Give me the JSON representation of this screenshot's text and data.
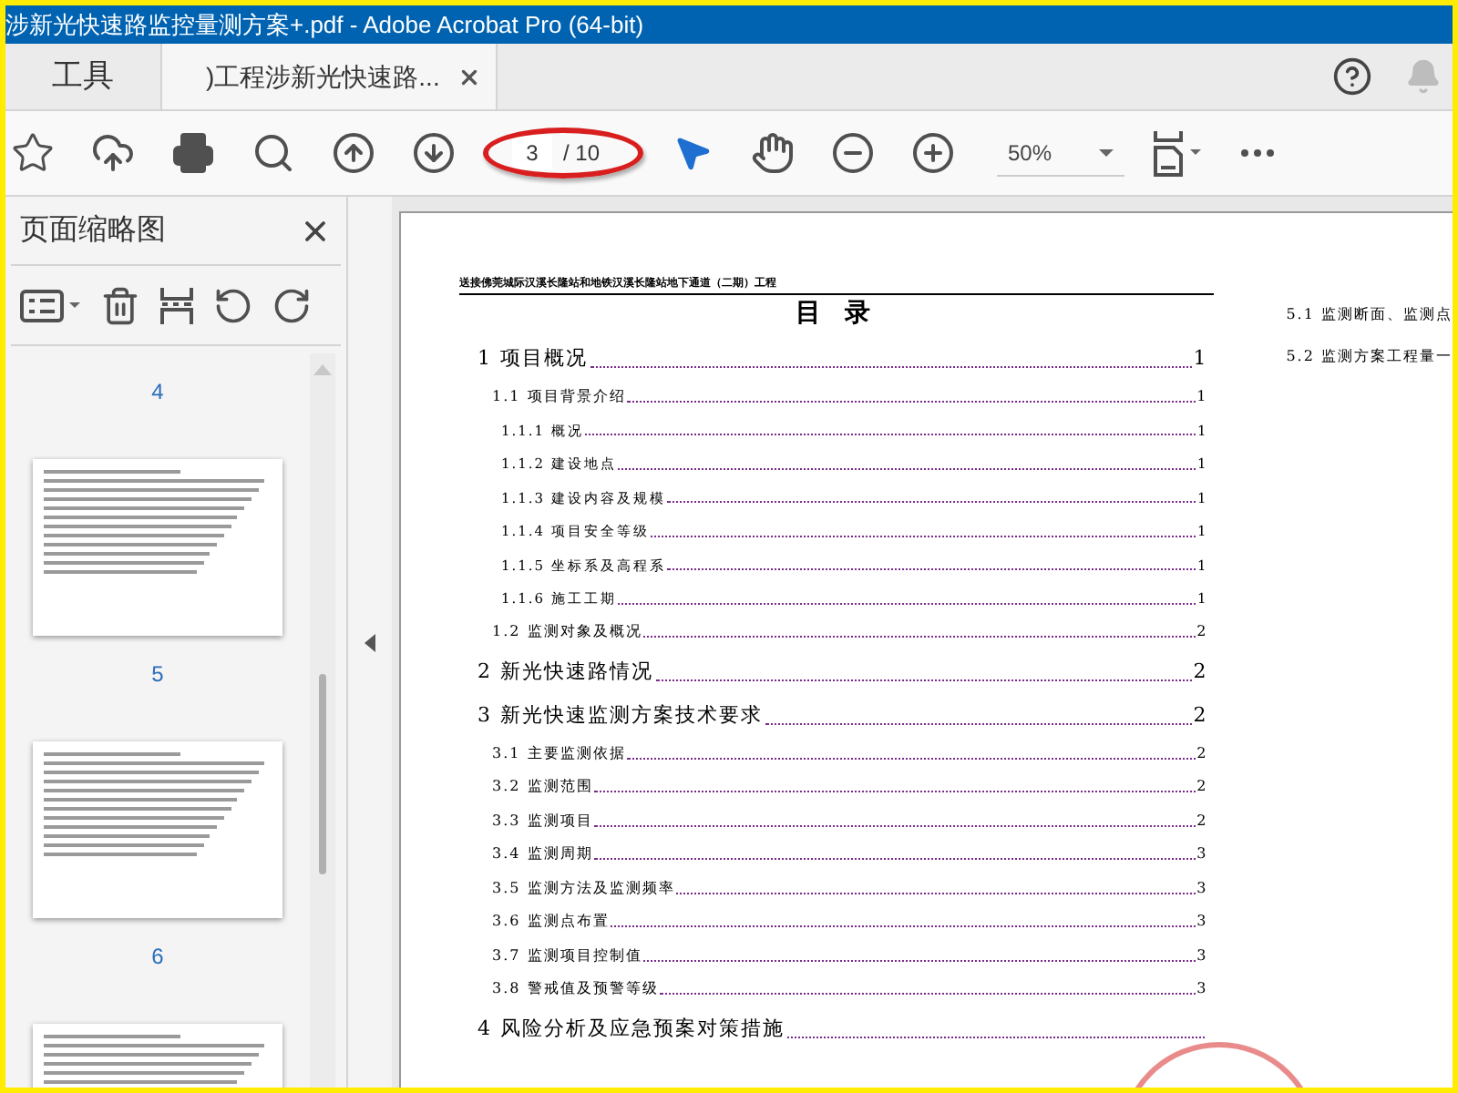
{
  "window": {
    "title": "涉新光快速路监控量测方案+.pdf - Adobe Acrobat Pro (64-bit)"
  },
  "tabs": [
    {
      "label": "工具",
      "selected": false,
      "kind": "tools"
    },
    {
      "label": ")工程涉新光快速路...",
      "selected": true,
      "kind": "document"
    }
  ],
  "toolbar": {
    "page_current": "3",
    "page_total": "/ 10",
    "zoom": "50%"
  },
  "sidebar": {
    "title": "页面缩略图",
    "thumbnails": [
      {
        "kind": "number",
        "label": "4"
      },
      {
        "kind": "thumbnail"
      },
      {
        "kind": "number",
        "label": "5"
      },
      {
        "kind": "thumbnail"
      },
      {
        "kind": "number",
        "label": "6"
      },
      {
        "kind": "thumbnail"
      }
    ]
  },
  "document": {
    "header": "送接佛莞城际汉溪长隆站和地铁汉溪长隆站地下通道（二期）工程",
    "toc_title": "目 录",
    "toc": [
      {
        "number": "1",
        "title": "项目概况",
        "page": "1",
        "children": [
          {
            "number": "1.1",
            "title": "项目背景介绍",
            "page": "1",
            "children": [
              {
                "number": "1.1.1",
                "title": "概况",
                "page": "1"
              },
              {
                "number": "1.1.2",
                "title": "建设地点",
                "page": "1"
              },
              {
                "number": "1.1.3",
                "title": "建设内容及规模",
                "page": "1"
              },
              {
                "number": "1.1.4",
                "title": "项目安全等级",
                "page": "1"
              },
              {
                "number": "1.1.5",
                "title": "坐标系及高程系",
                "page": "1"
              },
              {
                "number": "1.1.6",
                "title": "施工工期",
                "page": "1"
              }
            ]
          },
          {
            "number": "1.2",
            "title": "监测对象及概况",
            "page": "2"
          }
        ]
      },
      {
        "number": "2",
        "title": "新光快速路情况",
        "page": "2"
      },
      {
        "number": "3",
        "title": "新光快速监测方案技术要求",
        "page": "2",
        "children": [
          {
            "number": "3.1",
            "title": "主要监测依据",
            "page": "2"
          },
          {
            "number": "3.2",
            "title": "监测范围",
            "page": "2"
          },
          {
            "number": "3.3",
            "title": "监测项目",
            "page": "2"
          },
          {
            "number": "3.4",
            "title": "监测周期",
            "page": "3"
          },
          {
            "number": "3.5",
            "title": "监测方法及监测频率",
            "page": "3"
          },
          {
            "number": "3.6",
            "title": "监测点布置",
            "page": "3"
          },
          {
            "number": "3.7",
            "title": "监测项目控制值",
            "page": "3"
          },
          {
            "number": "3.8",
            "title": "警戒值及预警等级",
            "page": "3"
          }
        ]
      },
      {
        "number": "4",
        "title": "风险分析及应急预案对策措施"
      }
    ],
    "next_page_toc": [
      {
        "number": "5.1",
        "title": "监测断面、监测点"
      },
      {
        "number": "5.2",
        "title": "监测方案工程量一"
      }
    ]
  }
}
